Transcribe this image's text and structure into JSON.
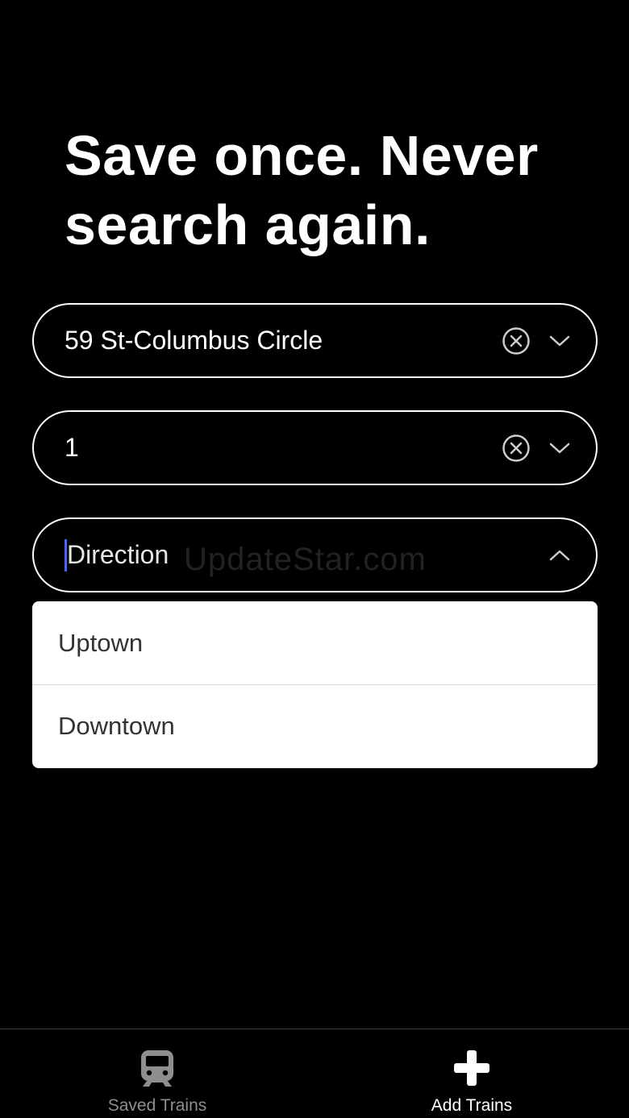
{
  "header": {
    "line1": "Save once. Never",
    "line2": "search again."
  },
  "fields": {
    "station": {
      "value": "59 St-Columbus Circle"
    },
    "line": {
      "value": "1"
    },
    "direction": {
      "placeholder": "Direction",
      "expanded": true
    }
  },
  "dropdown": {
    "options": [
      {
        "label": "Uptown"
      },
      {
        "label": "Downtown"
      }
    ]
  },
  "watermark": "UpdateStar.com",
  "tabbar": {
    "tabs": [
      {
        "label": "Saved Trains",
        "icon": "train-icon",
        "active": false
      },
      {
        "label": "Add Trains",
        "icon": "plus-icon",
        "active": true
      }
    ]
  },
  "colors": {
    "background": "#000000",
    "caret": "#4a63ff",
    "inactive_tab": "#8e8e8e"
  }
}
